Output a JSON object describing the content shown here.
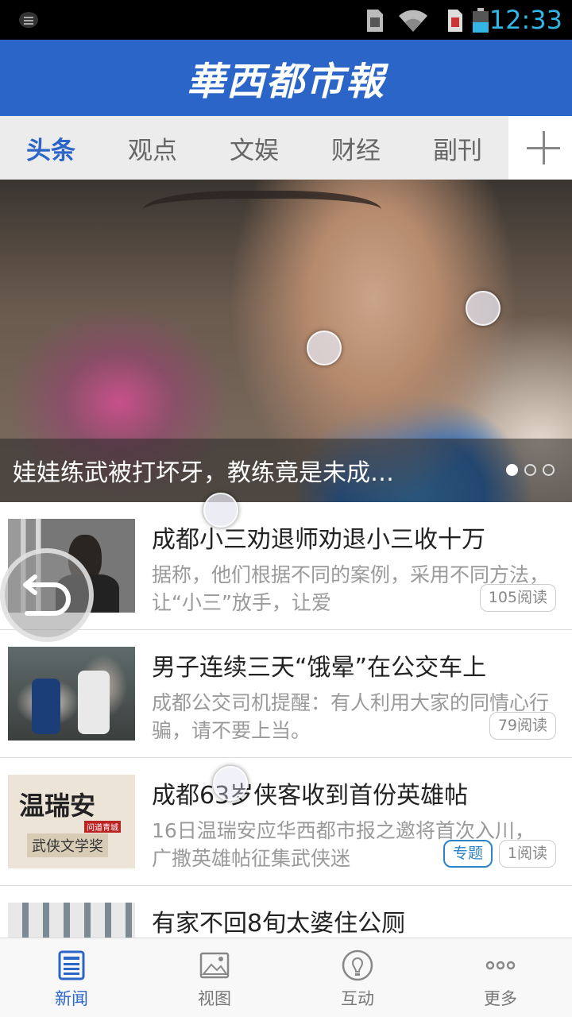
{
  "status_bar": {
    "time": "12:33",
    "icons": [
      "menu-icon",
      "sim-icon",
      "wifi-icon",
      "sim2-icon",
      "battery-icon"
    ]
  },
  "header": {
    "logo_text": "華西都市報"
  },
  "tabs": [
    {
      "label": "头条",
      "active": true
    },
    {
      "label": "观点",
      "active": false
    },
    {
      "label": "文娱",
      "active": false
    },
    {
      "label": "财经",
      "active": false
    },
    {
      "label": "副刊",
      "active": false
    }
  ],
  "hero": {
    "caption": "娃娃练武被打坏牙，教练竟是未成…",
    "page_count": 3,
    "current_page": 1
  },
  "news": [
    {
      "title": "成都小三劝退师劝退小三收十万",
      "summary": "据称，他们根据不同的案例，采用不同方法，让“小三”放手，让爱",
      "reads": "105阅读",
      "topic": ""
    },
    {
      "title": "男子连续三天“饿晕”在公交车上",
      "summary": "成都公交司机提醒：有人利用大家的同情心行骗，请不要上当。",
      "reads": "79阅读",
      "topic": ""
    },
    {
      "title": "成都63岁侠客收到首份英雄帖",
      "summary": "16日温瑞安应华西都市报之邀将首次入川，广撒英雄帖征集武侠迷",
      "reads": "1阅读",
      "topic": "专题",
      "thumb_text": {
        "line1": "温瑞安",
        "line2": "问道青城",
        "line3": "武侠文学奖"
      }
    },
    {
      "title": "有家不回8旬太婆住公厕",
      "summary": "",
      "reads": "",
      "topic": ""
    }
  ],
  "bottom_nav": [
    {
      "label": "新闻",
      "icon": "news-icon",
      "active": true
    },
    {
      "label": "视图",
      "icon": "image-icon",
      "active": false
    },
    {
      "label": "互动",
      "icon": "bulb-icon",
      "active": false
    },
    {
      "label": "更多",
      "icon": "more-icon",
      "active": false
    }
  ],
  "colors": {
    "brand": "#2b65c8",
    "status_time": "#33b5e5",
    "topic": "#2b83c8"
  }
}
